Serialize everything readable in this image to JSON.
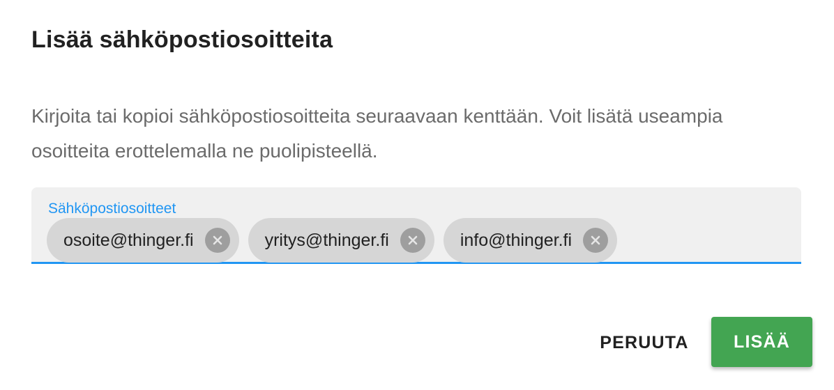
{
  "dialog": {
    "title": "Lisää sähköpostiosoitteita",
    "description": "Kirjoita tai kopioi sähköpostiosoitteita seuraavaan kenttään. Voit lisätä useampia osoitteita erottelemalla ne puolipisteellä.",
    "field": {
      "label": "Sähköpostiosoitteet",
      "chips": [
        {
          "email": "osoite@thinger.fi",
          "remove_icon": "close-circle-icon"
        },
        {
          "email": "yritys@thinger.fi",
          "remove_icon": "close-circle-icon"
        },
        {
          "email": "info@thinger.fi",
          "remove_icon": "close-circle-icon"
        }
      ]
    },
    "actions": {
      "cancel_label": "PERUUTA",
      "confirm_label": "LISÄÄ"
    }
  },
  "colors": {
    "accent": "#2196f3",
    "confirm": "#43a552",
    "chip": "#d6d6d6",
    "field_bg": "#f0f0f0"
  }
}
